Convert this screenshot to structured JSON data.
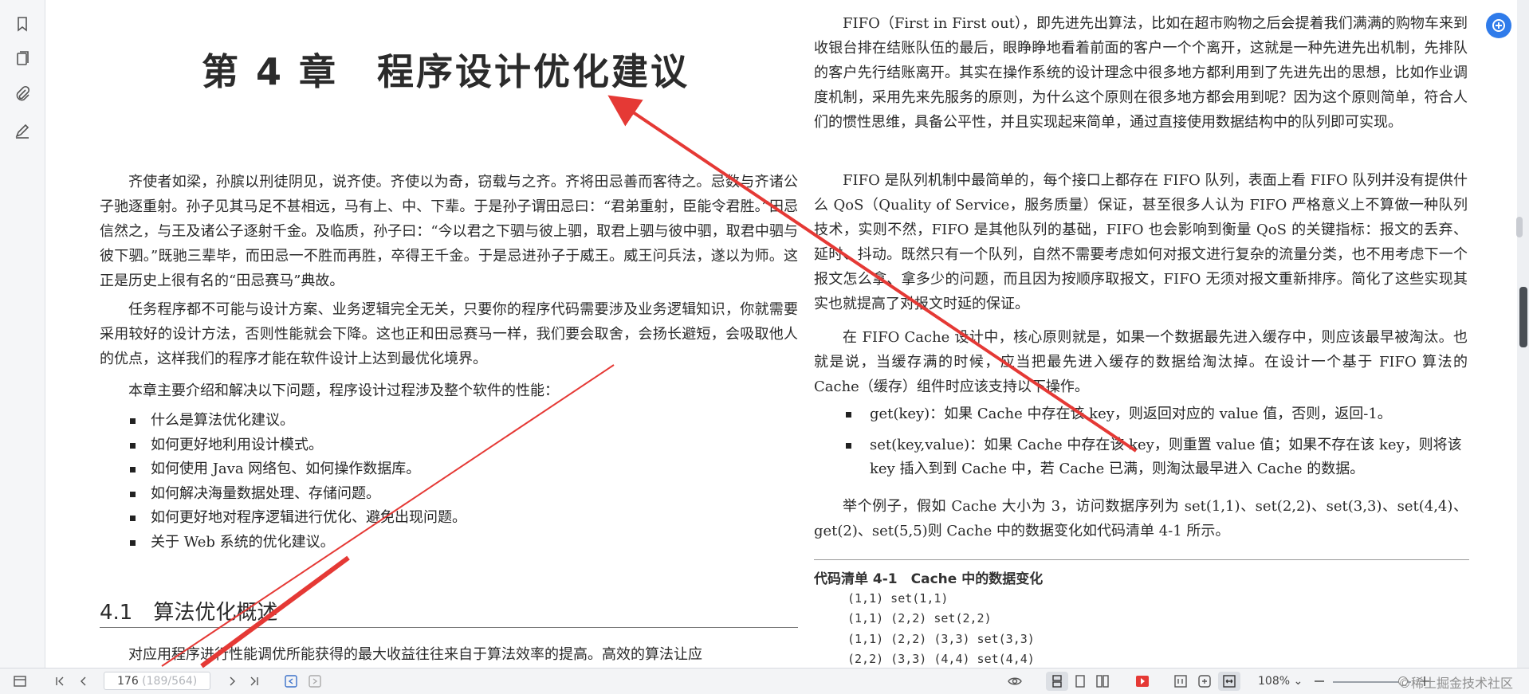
{
  "left_page": {
    "chapter_title": "第 4 章　程序设计优化建议",
    "intro_paragraph": "齐使者如梁，孙膑以刑徒阴见，说齐使。齐使以为奇，窃载与之齐。齐将田忌善而客待之。忌数与齐诸公子驰逐重射。孙子见其马足不甚相远，马有上、中、下辈。于是孙子谓田忌曰：“君弟重射，臣能令君胜。”田忌信然之，与王及诸公子逐射千金。及临质，孙子曰：“今以君之下驷与彼上驷，取君上驷与彼中驷，取君中驷与彼下驷。”既驰三辈毕，而田忌一不胜而再胜，卒得王千金。于是忌进孙子于威王。威王问兵法，遂以为师。这正是历史上很有名的“田忌赛马”典故。",
    "paragraph_2": "任务程序都不可能与设计方案、业务逻辑完全无关，只要你的程序代码需要涉及业务逻辑知识，你就需要采用较好的设计方法，否则性能就会下降。这也正和田忌赛马一样，我们要会取舍，会扬长避短，会吸取他人的优点，这样我们的程序才能在软件设计上达到最优化境界。",
    "paragraph_3": "本章主要介绍和解决以下问题，程序设计过程涉及整个软件的性能：",
    "bullets": [
      "什么是算法优化建议。",
      "如何更好地利用设计模式。",
      "如何使用 Java 网络包、如何操作数据库。",
      "如何解决海量数据处理、存储问题。",
      "如何更好地对程序逻辑进行优化、避免出现问题。",
      "关于 Web 系统的优化建议。"
    ],
    "section_heading": "4.1　算法优化概述",
    "section_paragraph": "对应用程序进行性能调优所能获得的最大收益往往来自于算法效率的提高。高效的算法让应"
  },
  "right_page": {
    "paragraph_1": "FIFO（First in First out），即先进先出算法，比如在超市购物之后会提着我们满满的购物车来到收银台排在结账队伍的最后，眼睁睁地看着前面的客户一个个离开，这就是一种先进先出机制，先排队的客户先行结账离开。其实在操作系统的设计理念中很多地方都利用到了先进先出的思想，比如作业调度机制，采用先来先服务的原则，为什么这个原则在很多地方都会用到呢？因为这个原则简单，符合人们的惯性思维，具备公平性，并且实现起来简单，通过直接使用数据结构中的队列即可实现。",
    "paragraph_2": "FIFO 是队列机制中最简单的，每个接口上都存在 FIFO 队列，表面上看 FIFO 队列并没有提供什么 QoS（Quality of Service，服务质量）保证，甚至很多人认为 FIFO 严格意义上不算做一种队列技术，实则不然，FIFO 是其他队列的基础，FIFO 也会影响到衡量 QoS 的关键指标：报文的丢弃、延时、抖动。既然只有一个队列，自然不需要考虑如何对报文进行复杂的流量分类，也不用考虑下一个报文怎么拿、拿多少的问题，而且因为按顺序取报文，FIFO 无须对报文重新排序。简化了这些实现其实也就提高了对报文时延的保证。",
    "paragraph_3": "在 FIFO Cache 设计中，核心原则就是，如果一个数据最先进入缓存中，则应该最早被淘汰。也就是说，当缓存满的时候，应当把最先进入缓存的数据给淘汰掉。在设计一个基于 FIFO 算法的 Cache（缓存）组件时应该支持以下操作。",
    "bullets": [
      "get(key)：如果 Cache 中存在该 key，则返回对应的 value 值，否则，返回-1。",
      "set(key,value)：如果 Cache 中存在该 key，则重置 value 值；如果不存在该 key，则将该 key 插入到到 Cache 中，若 Cache 已满，则淘汰最早进入 Cache 的数据。"
    ],
    "paragraph_4": "举个例子，假如 Cache 大小为 3，访问数据序列为 set(1,1)、set(2,2)、set(3,3)、set(4,4)、get(2)、set(5,5)则 Cache 中的数据变化如代码清单 4-1 所示。",
    "code_caption": "代码清单 4-1　Cache 中的数据变化",
    "code_lines": [
      "(1,1) set(1,1)",
      "(1,1) (2,2) set(2,2)",
      "(1,1) (2,2) (3,3) set(3,3)",
      "(2,2) (3,3) (4,4) set(4,4)"
    ]
  },
  "bottom_bar": {
    "page_current": "176",
    "page_detail": " (189/564)",
    "zoom": "108%",
    "watermark": "©稀土掘金技术社区"
  },
  "colors": {
    "annotation_arrow": "#e53935",
    "accent": "#2f7bea"
  }
}
